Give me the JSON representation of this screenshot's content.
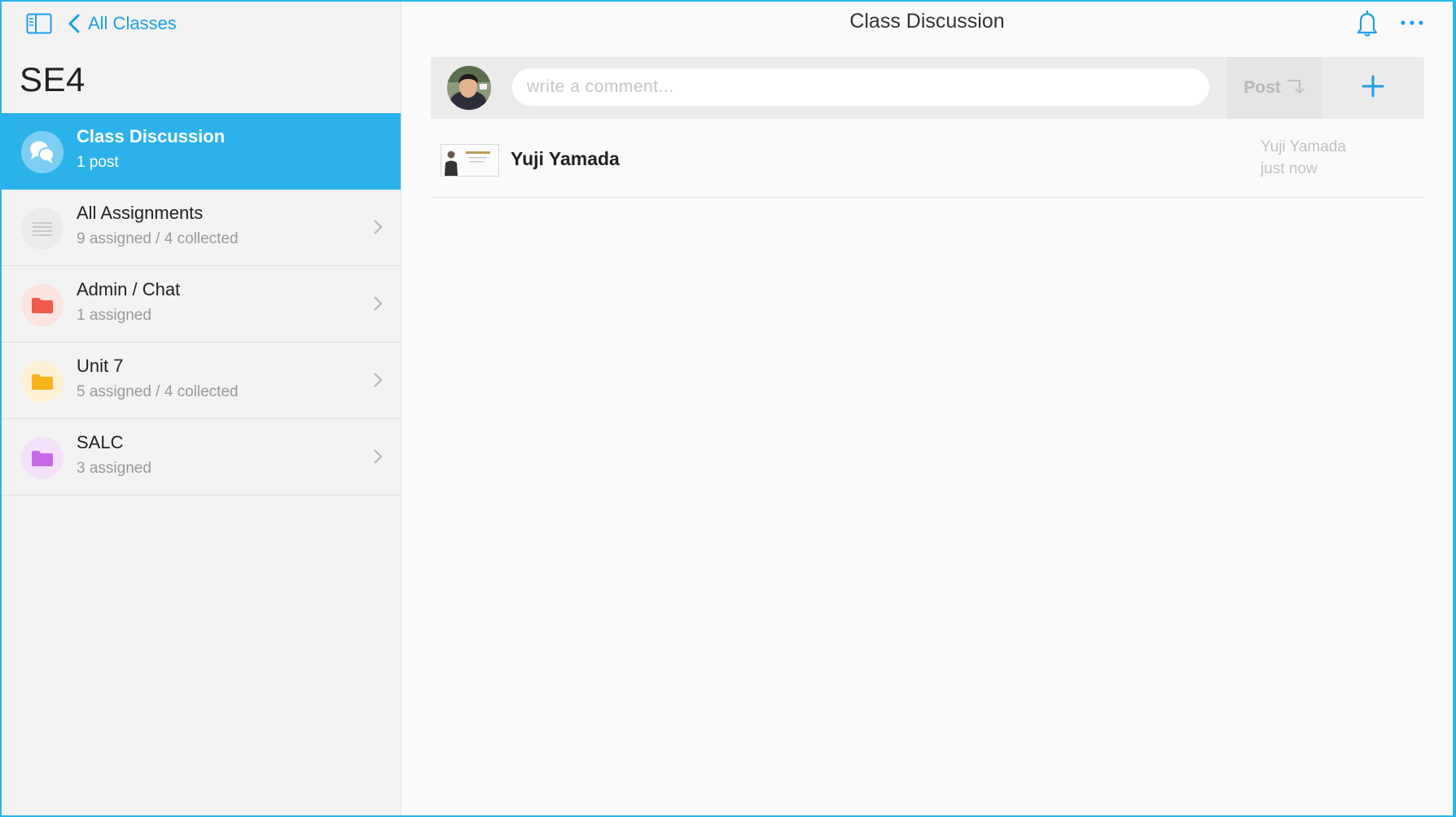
{
  "header": {
    "back_label": "All Classes",
    "page_title": "Class Discussion"
  },
  "sidebar": {
    "class_title": "SE4",
    "items": [
      {
        "title": "Class Discussion",
        "subtitle": "1 post",
        "icon": "chat-bubbles-icon",
        "color": "#2cb2ea",
        "active": true
      },
      {
        "title": "All Assignments",
        "subtitle": "9 assigned / 4 collected",
        "icon": "list-icon",
        "color": "#c9c9c9",
        "active": false
      },
      {
        "title": "Admin / Chat",
        "subtitle": "1 assigned",
        "icon": "folder-icon",
        "color": "#ef5a4c",
        "active": false
      },
      {
        "title": "Unit 7",
        "subtitle": "5 assigned / 4 collected",
        "icon": "folder-icon",
        "color": "#f7b21c",
        "active": false
      },
      {
        "title": "SALC",
        "subtitle": "3 assigned",
        "icon": "folder-icon",
        "color": "#c66be8",
        "active": false
      }
    ]
  },
  "composer": {
    "placeholder": "write a comment...",
    "value": "",
    "post_label": "Post"
  },
  "posts": [
    {
      "author": "Yuji Yamada",
      "meta_author": "Yuji Yamada",
      "time": "just now"
    }
  ],
  "colors": {
    "accent": "#2cb2ea",
    "link": "#1f9ee8",
    "frame": "#27b6e6"
  }
}
